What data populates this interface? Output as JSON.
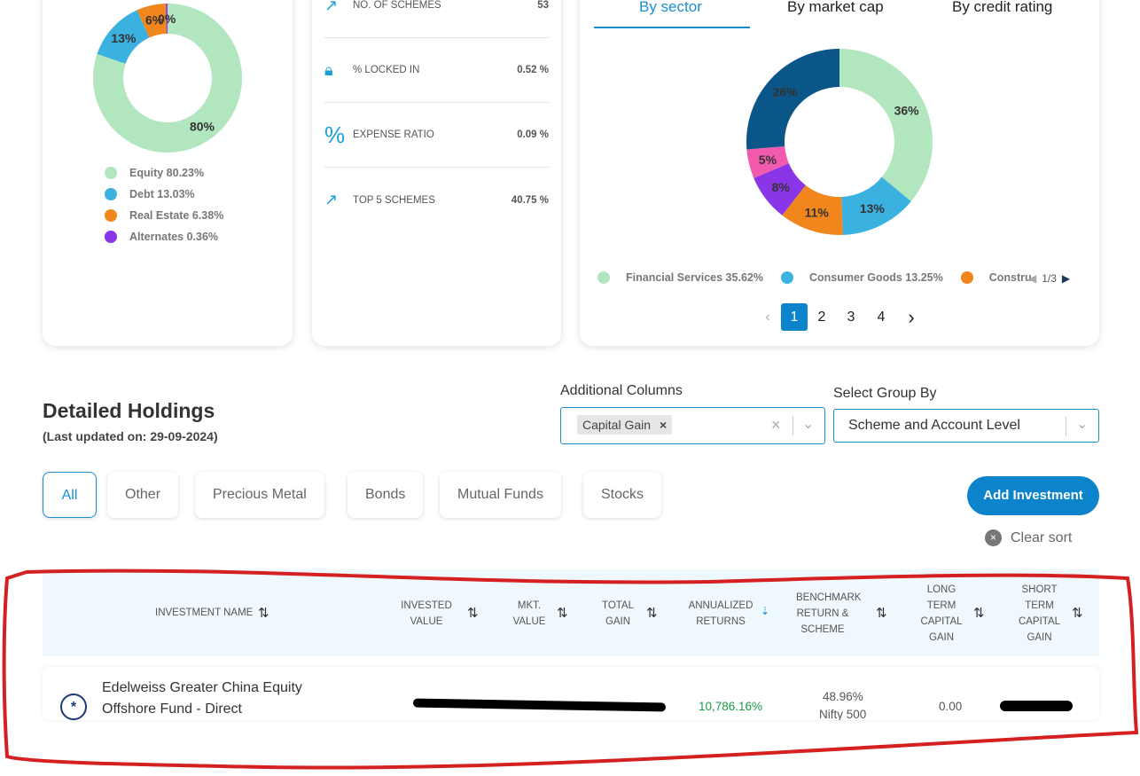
{
  "asset_allocation": {
    "labels_on_chart": [
      "80%",
      "13%",
      "6%",
      "0%"
    ],
    "legend": [
      {
        "label": "Equity 80.23%",
        "value": 80.23,
        "color": "#b2e6bf"
      },
      {
        "label": "Debt 13.03%",
        "value": 13.03,
        "color": "#3bb1e0"
      },
      {
        "label": "Real Estate 6.38%",
        "value": 6.38,
        "color": "#f0861c"
      },
      {
        "label": "Alternates 0.36%",
        "value": 0.36,
        "color": "#8a35e8"
      }
    ]
  },
  "stats": [
    {
      "icon": "trending-up-icon",
      "label": "NO. OF SCHEMES",
      "value": "53"
    },
    {
      "icon": "lock-icon",
      "label": "% LOCKED IN",
      "value": "0.52 %"
    },
    {
      "icon": "percent-icon",
      "label": "EXPENSE RATIO",
      "value": "0.09 %"
    },
    {
      "icon": "trending-up-icon",
      "label": "TOP 5 SCHEMES",
      "value": "40.75 %"
    }
  ],
  "sector_card": {
    "tabs": [
      "By sector",
      "By market cap",
      "By credit rating"
    ],
    "active_tab": 0,
    "slices": [
      {
        "label": "36%",
        "value": 35.62,
        "color": "#b2e6bf"
      },
      {
        "label": "13%",
        "value": 13.25,
        "color": "#3bb1e0"
      },
      {
        "label": "11%",
        "value": 11,
        "color": "#f0861c"
      },
      {
        "label": "8%",
        "value": 8,
        "color": "#8a35e8"
      },
      {
        "label": "5%",
        "value": 5,
        "color": "#f25aae"
      },
      {
        "label": "26%",
        "value": 26,
        "color": "#0b5689"
      }
    ],
    "legend": [
      {
        "label": "Financial Services 35.62%",
        "color": "#b2e6bf"
      },
      {
        "label": "Consumer Goods 13.25%",
        "color": "#3bb1e0"
      },
      {
        "label": "Constru",
        "color": "#f0861c"
      }
    ],
    "legend_page": "1/3",
    "pages": [
      "1",
      "2",
      "3",
      "4"
    ],
    "current_page": "1"
  },
  "holdings": {
    "title": "Detailed Holdings",
    "updated": "(Last updated on: 29-09-2024)",
    "additional_columns_label": "Additional Columns",
    "additional_columns_chip": "Capital Gain",
    "group_by_label": "Select Group By",
    "group_by_value": "Scheme and Account Level",
    "filters": [
      "All",
      "Other",
      "Precious Metal",
      "Bonds",
      "Mutual Funds",
      "Stocks"
    ],
    "add_button": "Add Investment",
    "clear_sort": "Clear sort",
    "columns": [
      "INVESTMENT NAME",
      "INVESTED VALUE",
      "MKT. VALUE",
      "TOTAL GAIN",
      "ANNUALIZED RETURNS",
      "BENCHMARK RETURN & SCHEME",
      "LONG TERM CAPITAL GAIN",
      "SHORT TERM CAPITAL GAIN"
    ],
    "rows": [
      {
        "name": "Edelweiss Greater China Equity Offshore Fund - Direct",
        "annualized": "10,786.16%",
        "benchmark_return": "48.96%",
        "benchmark_scheme": "Nifty 500",
        "ltcg": "0.00"
      }
    ]
  }
}
